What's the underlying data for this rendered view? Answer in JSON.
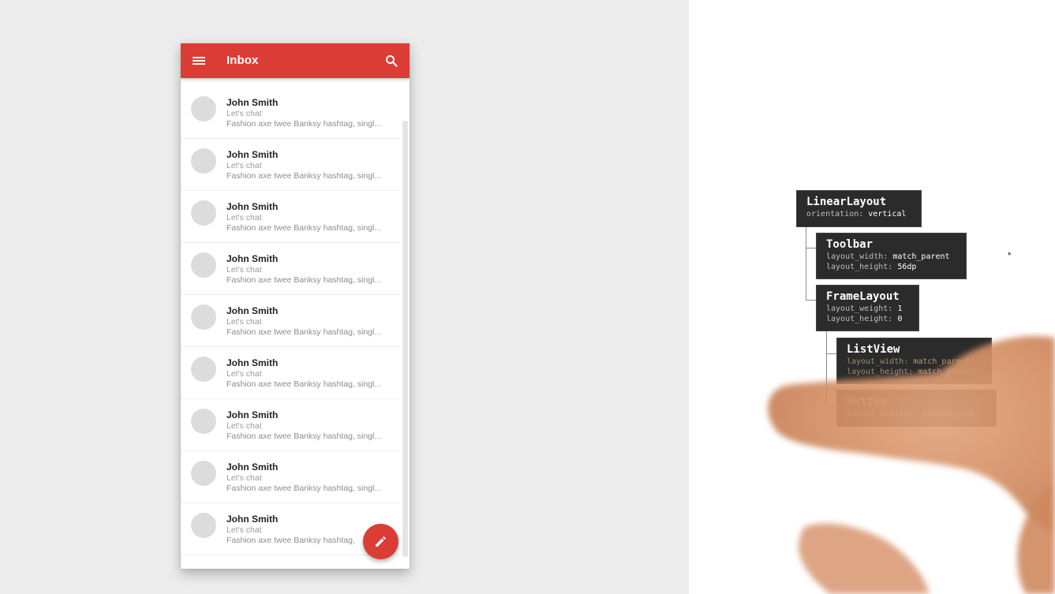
{
  "app": {
    "toolbar": {
      "title": "Inbox",
      "menu_icon": "menu-icon",
      "search_icon": "search-icon",
      "color": "#db3d36"
    },
    "messages": [
      {
        "name": "John Smith",
        "subject": "Let's chat",
        "preview": "Fashion axe twee Banksy hashtag, singl..."
      },
      {
        "name": "John Smith",
        "subject": "Let's chat",
        "preview": "Fashion axe twee Banksy hashtag, singl..."
      },
      {
        "name": "John Smith",
        "subject": "Let's chat",
        "preview": "Fashion axe twee Banksy hashtag, singl..."
      },
      {
        "name": "John Smith",
        "subject": "Let's chat",
        "preview": "Fashion axe twee Banksy hashtag, singl..."
      },
      {
        "name": "John Smith",
        "subject": "Let's chat",
        "preview": "Fashion axe twee Banksy hashtag, singl..."
      },
      {
        "name": "John Smith",
        "subject": "Let's chat",
        "preview": "Fashion axe twee Banksy hashtag, singl..."
      },
      {
        "name": "John Smith",
        "subject": "Let's chat",
        "preview": "Fashion axe twee Banksy hashtag, singl..."
      },
      {
        "name": "John Smith",
        "subject": "Let's chat",
        "preview": "Fashion axe twee Banksy hashtag, singl..."
      },
      {
        "name": "John Smith",
        "subject": "Let's chat",
        "preview": "Fashion axe twee Banksy hashtag,"
      }
    ],
    "fab": {
      "icon": "pencil-icon"
    }
  },
  "hierarchy": {
    "linear_layout": {
      "title": "LinearLayout",
      "props": [
        {
          "key": "orientation:",
          "value": "vertical"
        }
      ]
    },
    "toolbar": {
      "title": "Toolbar",
      "props": [
        {
          "key": "layout_width:",
          "value": "match_parent"
        },
        {
          "key": "layout_height:",
          "value": "56dp"
        }
      ]
    },
    "frame_layout": {
      "title": "FrameLayout",
      "props": [
        {
          "key": "layout_weight:",
          "value": "1"
        },
        {
          "key": "layout_height:",
          "value": "0"
        }
      ]
    },
    "list_view": {
      "title": "ListView",
      "props": [
        {
          "key": "layout_width:",
          "value": "match_parent"
        },
        {
          "key": "layout_height:",
          "value": "match_parent"
        }
      ]
    },
    "button": {
      "title": "Button",
      "props": [
        {
          "key": "layout_gravity:",
          "value": "bottom|right"
        }
      ]
    }
  }
}
